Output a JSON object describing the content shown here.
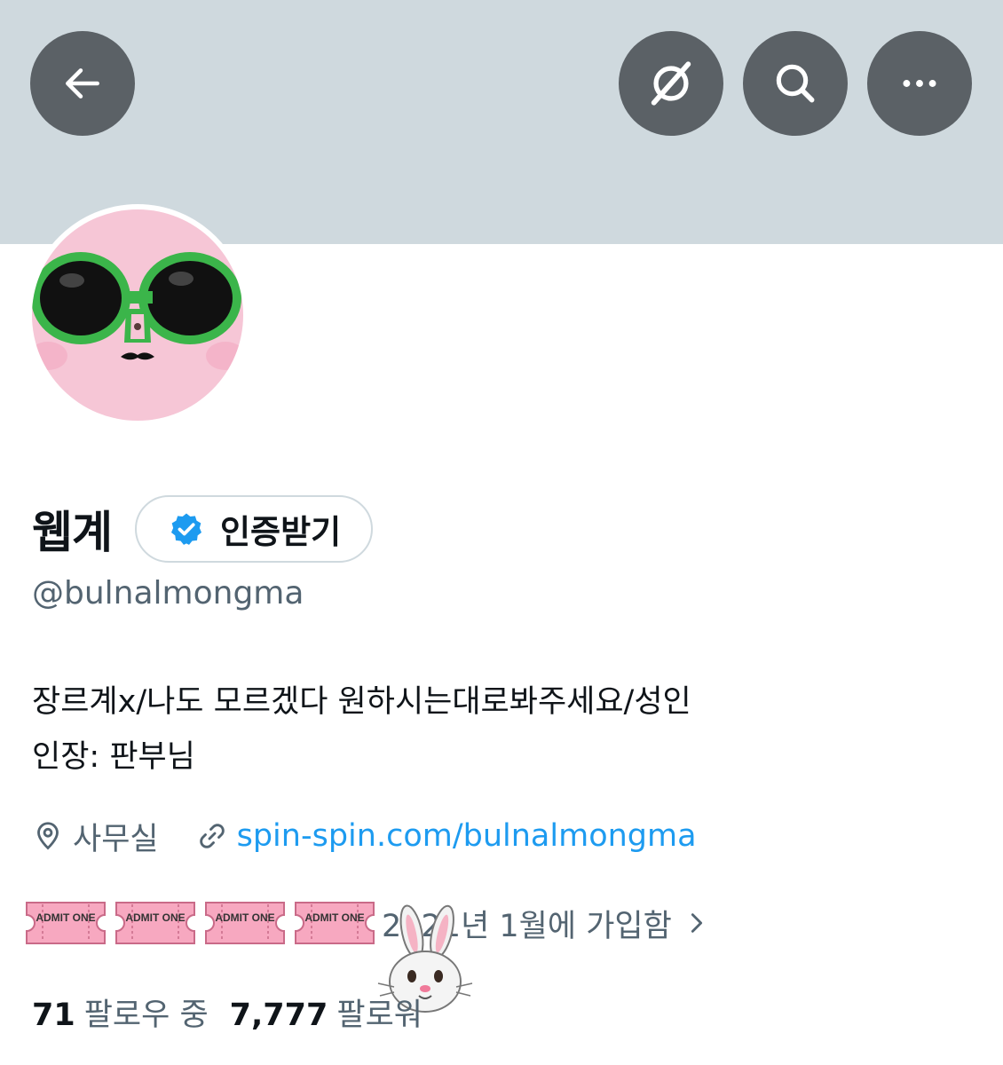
{
  "header": {
    "back_icon": "arrow-left-icon",
    "grok_icon": "grok-slash-circle-icon",
    "search_icon": "search-icon",
    "more_icon": "more-horizontal-icon",
    "banner_color": "#cfd9de",
    "button_color": "#5b6166"
  },
  "profile": {
    "display_name": "웹계",
    "verify_label": "인증받기",
    "handle": "@bulnalmongma",
    "bio_lines": [
      "장르계x/나도 모르겠다 원하시는대로봐주세요/성인",
      "인장: 판부님"
    ],
    "location": "사무실",
    "url": "spin-spin.com/bulnalmongma",
    "tickets": [
      "ADMIT ONE",
      "ADMIT ONE",
      "ADMIT ONE",
      "ADMIT ONE"
    ],
    "joined": "2021년 1월에 가입함",
    "following_count": "71",
    "following_label": "팔로우 중",
    "followers_count": "7,777",
    "followers_label": "팔로워"
  },
  "colors": {
    "accent": "#1d9bf0",
    "secondary_text": "#536471",
    "primary_text": "#0f1419"
  }
}
